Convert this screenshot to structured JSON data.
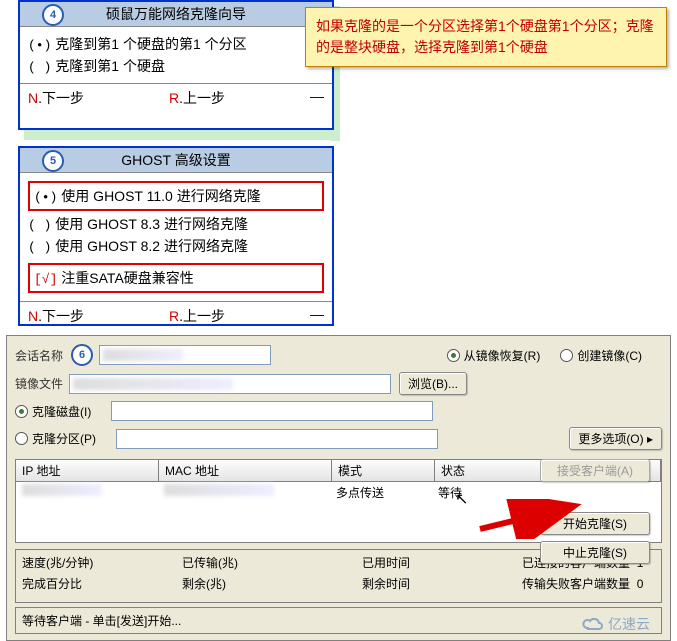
{
  "box4": {
    "badge": "4",
    "title": "硕鼠万能网络克隆向导",
    "options": [
      {
        "mark": "(•)",
        "text": "克隆到第1 个硬盘的第1 个分区"
      },
      {
        "mark": "( )",
        "text": "克隆到第1 个硬盘"
      }
    ],
    "footer_next": "N.下一步",
    "footer_prev": "R.上一步",
    "footer_dash": "—"
  },
  "callout": "如果克隆的是一个分区选择第1个硬盘第1个分区；克隆的是整块硬盘，选择克隆到第1个硬盘",
  "box5": {
    "badge": "5",
    "title": "GHOST 高级设置",
    "group1": [
      {
        "mark": "(•)",
        "text": "使用 GHOST 11.0 进行网络克隆",
        "highlighted": true
      },
      {
        "mark": "( )",
        "text": "使用 GHOST  8.3 进行网络克隆",
        "highlighted": false
      },
      {
        "mark": "( )",
        "text": "使用 GHOST  8.2 进行网络克隆",
        "highlighted": false
      }
    ],
    "group2": {
      "mark": "[√]",
      "text": "注重SATA硬盘兼容性"
    },
    "footer_next": "N.下一步",
    "footer_prev": "R.上一步",
    "footer_dash": "—"
  },
  "panel6": {
    "badge": "6",
    "session_label": "会话名称",
    "restore_label": "从镜像恢复(R)",
    "create_label": "创建镜像(C)",
    "image_label": "镜像文件",
    "browse": "浏览(B)...",
    "clone_disk": "克隆磁盘(I)",
    "clone_part": "克隆分区(P)",
    "more_options": "更多选项(O)",
    "columns": {
      "ip": "IP 地址",
      "mac": "MAC 地址",
      "mode": "模式",
      "status": "状态"
    },
    "row": {
      "mode": "多点传送",
      "status": "等待"
    },
    "side_buttons": {
      "accept": "接受客户端(A)",
      "start": "开始克隆(S)",
      "stop": "中止克隆(S)"
    },
    "stats": {
      "speed_label": "速度(兆/分钟)",
      "sent_label": "已传输(兆)",
      "elapsed_label": "已用时间",
      "connected_label": "已连接的客户端数量",
      "connected_value": "1",
      "percent_label": "完成百分比",
      "remain_label": "剩余(兆)",
      "remain_time_label": "剩余时间",
      "failed_label": "传输失败客户端数量",
      "failed_value": "0"
    },
    "footer": "等待客户端 - 单击[发送]开始..."
  },
  "watermark": "亿速云"
}
